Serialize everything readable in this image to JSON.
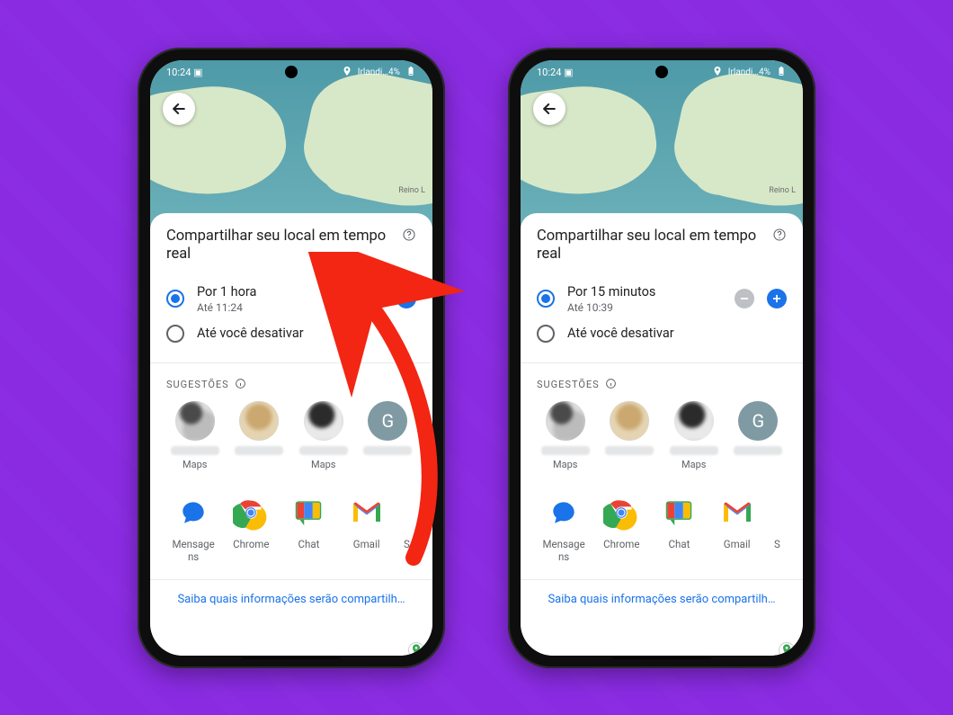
{
  "background": {
    "color": "#8a2be2"
  },
  "statusbar": {
    "time": "10:24",
    "indicator": "▣",
    "right_text": "Irlandi…4%",
    "icon_names": [
      "location-icon",
      "signal-icon",
      "battery-icon"
    ]
  },
  "map": {
    "label_reino": "Reino L"
  },
  "sheet": {
    "title": "Compartilhar seu local em tempo real",
    "help_aria": "Ajuda",
    "option_duration_label": {
      "left": "Por 1 hora",
      "right": "Por 15 minutos"
    },
    "option_duration_until": {
      "left": "Até 11:24",
      "right": "Até 10:39"
    },
    "option_until_off": "Até você desativar",
    "minus_disabled": {
      "left": false,
      "right": true
    },
    "suggestions_label": "SUGESTÕES",
    "suggestions": [
      {
        "app": "Maps",
        "badge": "maps"
      },
      {
        "app": "",
        "badge": ""
      },
      {
        "app": "Maps",
        "badge": "maps"
      },
      {
        "app": "",
        "badge": "",
        "initial": "G"
      }
    ],
    "apps": [
      {
        "name": "Mensagens",
        "wrapped": "Mensage\nns",
        "icon": "messages"
      },
      {
        "name": "Chrome",
        "wrapped": "Chrome",
        "icon": "chrome"
      },
      {
        "name": "Chat",
        "wrapped": "Chat",
        "icon": "chat"
      },
      {
        "name": "Gmail",
        "wrapped": "Gmail",
        "icon": "gmail"
      },
      {
        "name": "S",
        "wrapped": "S",
        "icon": "cut"
      }
    ],
    "footer_link": "Saiba quais informações serão compartilh…"
  },
  "annotation": {
    "points_to": "minus-button",
    "color": "#f22613"
  }
}
